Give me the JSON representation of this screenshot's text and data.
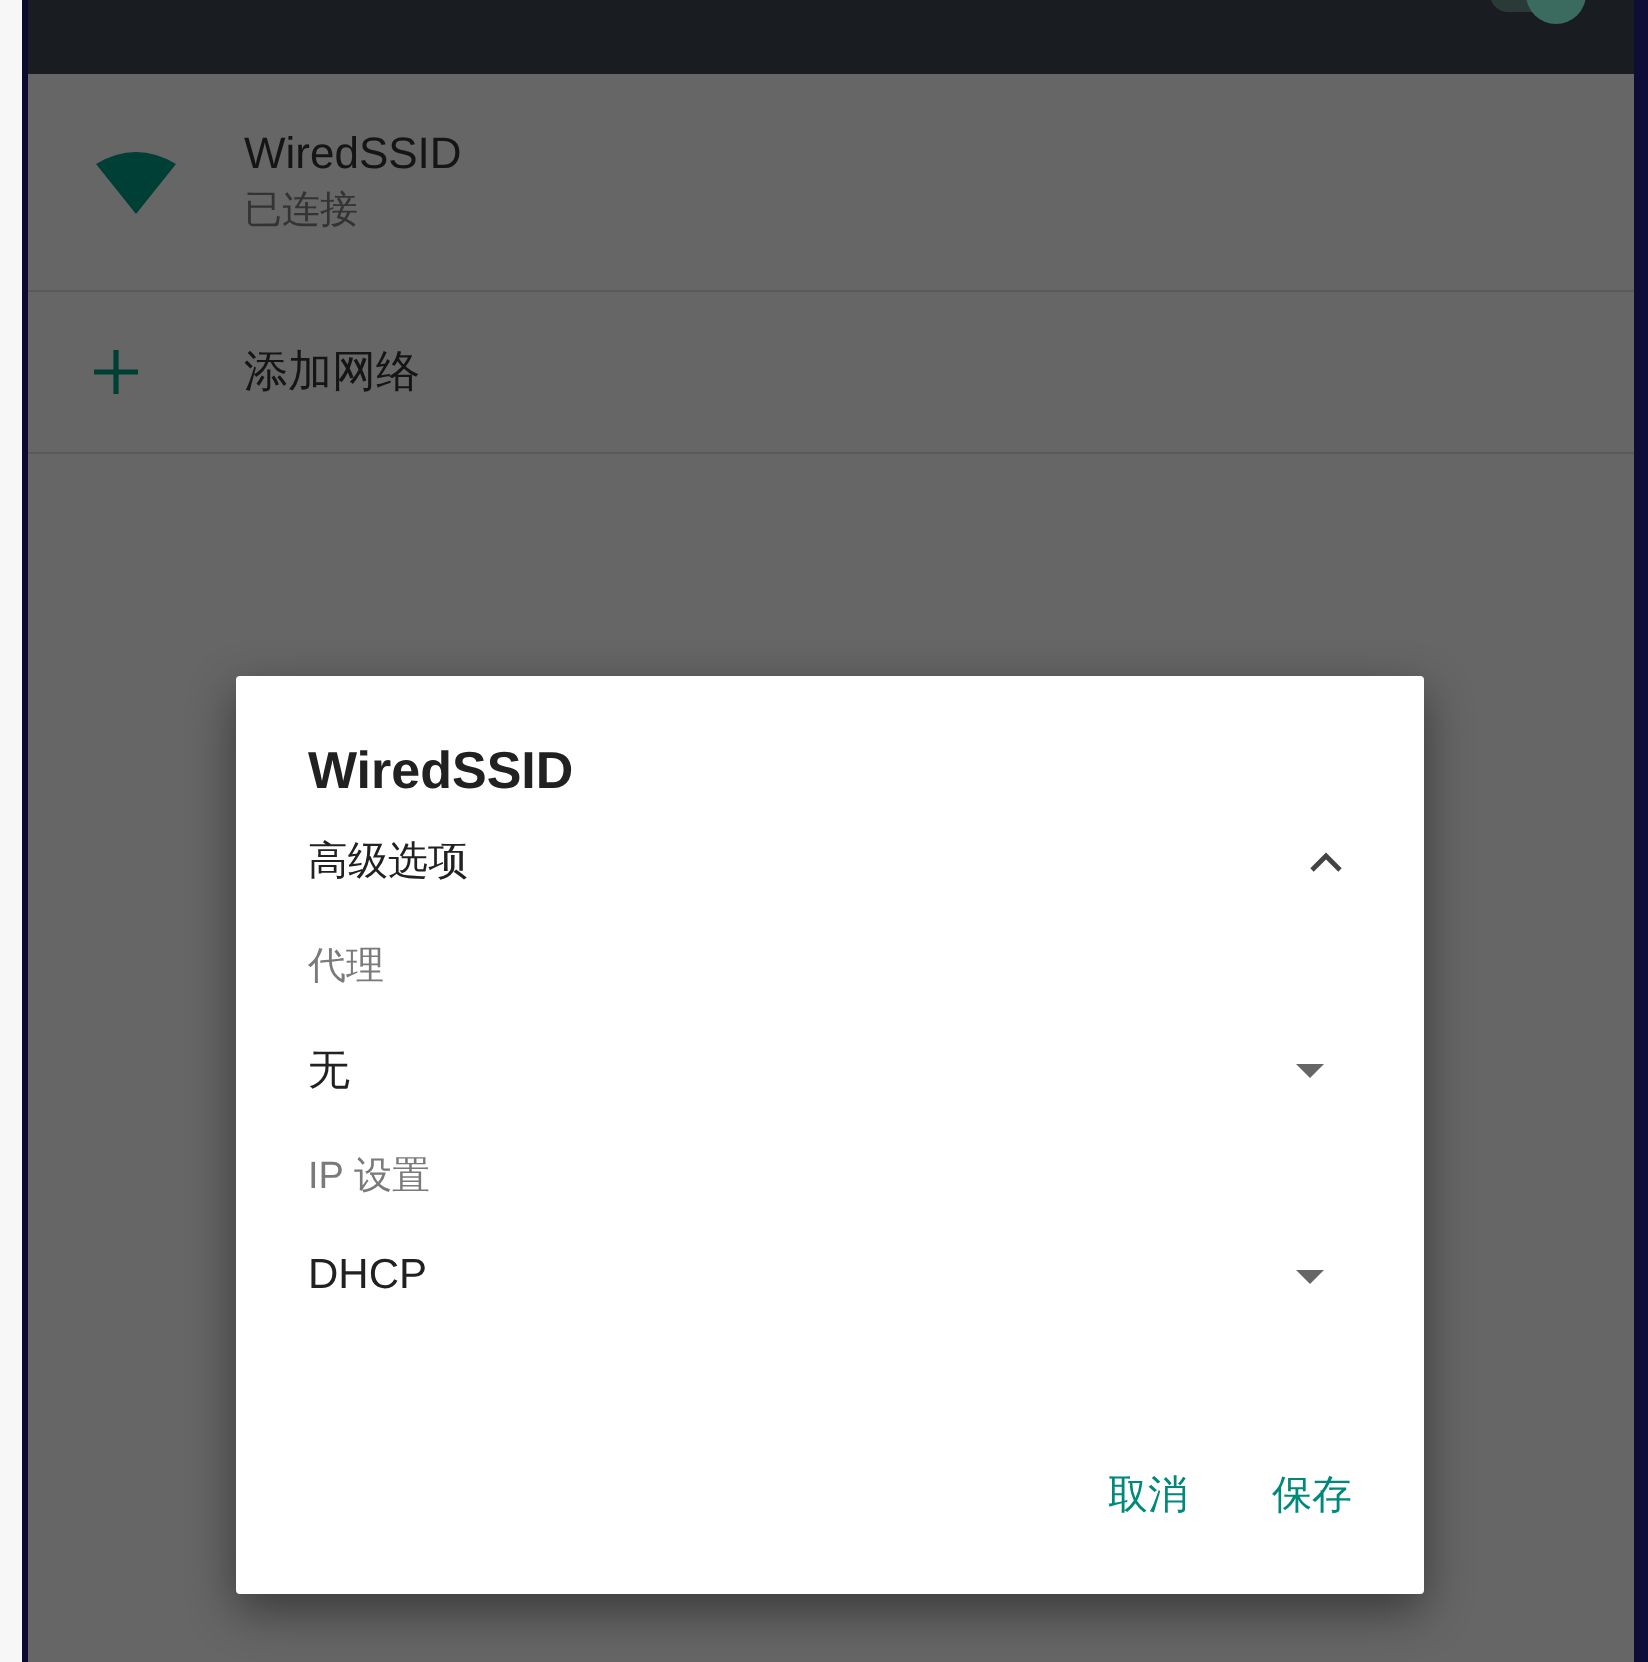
{
  "header": {
    "toggle": {
      "on": true
    }
  },
  "networks": [
    {
      "kind": "network",
      "name": "WiredSSID",
      "status": "已连接"
    },
    {
      "kind": "add",
      "name": "添加网络"
    }
  ],
  "dialog": {
    "title": "WiredSSID",
    "advanced": {
      "label": "高级选项",
      "expanded": true
    },
    "fields": [
      {
        "label": "代理",
        "value": "无"
      },
      {
        "label": "IP 设置",
        "value": "DHCP"
      }
    ],
    "buttons": [
      "取消",
      "保存"
    ]
  }
}
